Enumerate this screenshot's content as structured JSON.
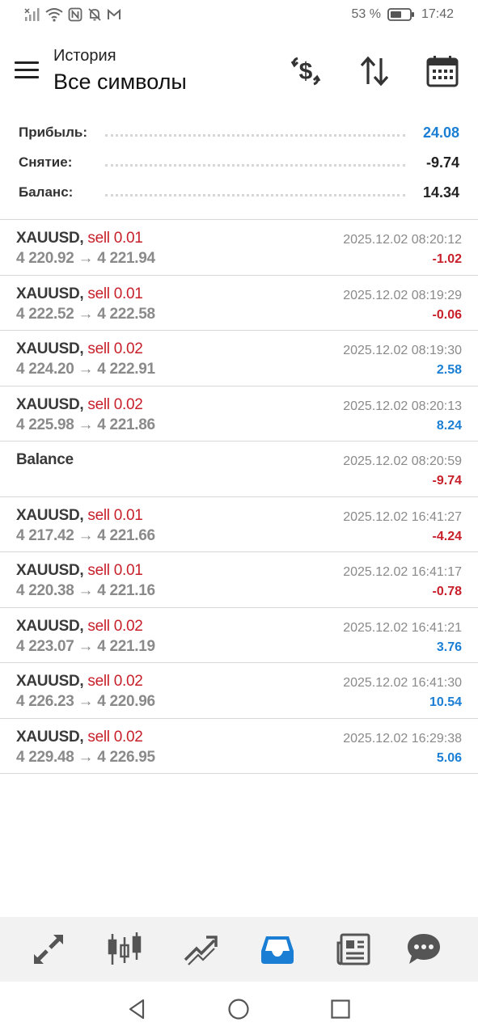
{
  "status_bar": {
    "battery_percent": "53 %",
    "time": "17:42",
    "icons": [
      "signal-icon",
      "wifi-icon",
      "nfc-icon",
      "bell-off-icon",
      "gmail-icon"
    ]
  },
  "header": {
    "title": "История",
    "subtitle": "Все символы",
    "actions": [
      "currency-exchange-icon",
      "sort-icon",
      "calendar-icon"
    ]
  },
  "summary": {
    "profit_label": "Прибыль:",
    "profit_value": "24.08",
    "withdrawal_label": "Снятие:",
    "withdrawal_value": "-9.74",
    "balance_label": "Баланс:",
    "balance_value": "14.34",
    "profit_color": "#1a7fd4"
  },
  "deals": [
    {
      "symbol": "XAUUSD,",
      "type": "sell 0.01",
      "prices": "4 220.92 → 4 221.94",
      "time": "2025.12.02 08:20:12",
      "profit": "-1.02",
      "sign": "neg"
    },
    {
      "symbol": "XAUUSD,",
      "type": "sell 0.01",
      "prices": "4 222.52 → 4 222.58",
      "time": "2025.12.02 08:19:29",
      "profit": "-0.06",
      "sign": "neg"
    },
    {
      "symbol": "XAUUSD,",
      "type": "sell 0.02",
      "prices": "4 224.20 → 4 222.91",
      "time": "2025.12.02 08:19:30",
      "profit": "2.58",
      "sign": "pos"
    },
    {
      "symbol": "XAUUSD,",
      "type": "sell 0.02",
      "prices": "4 225.98 → 4 221.86",
      "time": "2025.12.02 08:20:13",
      "profit": "8.24",
      "sign": "pos"
    },
    {
      "symbol": "Balance",
      "type": "",
      "prices": "",
      "time": "2025.12.02 08:20:59",
      "profit": "-9.74",
      "sign": "neg"
    },
    {
      "symbol": "XAUUSD,",
      "type": "sell 0.01",
      "prices": "4 217.42 → 4 221.66",
      "time": "2025.12.02 16:41:27",
      "profit": "-4.24",
      "sign": "neg"
    },
    {
      "symbol": "XAUUSD,",
      "type": "sell 0.01",
      "prices": "4 220.38 → 4 221.16",
      "time": "2025.12.02 16:41:17",
      "profit": "-0.78",
      "sign": "neg"
    },
    {
      "symbol": "XAUUSD,",
      "type": "sell 0.02",
      "prices": "4 223.07 → 4 221.19",
      "time": "2025.12.02 16:41:21",
      "profit": "3.76",
      "sign": "pos"
    },
    {
      "symbol": "XAUUSD,",
      "type": "sell 0.02",
      "prices": "4 226.23 → 4 220.96",
      "time": "2025.12.02 16:41:30",
      "profit": "10.54",
      "sign": "pos"
    },
    {
      "symbol": "XAUUSD,",
      "type": "sell 0.02",
      "prices": "4 229.48 → 4 226.95",
      "time": "2025.12.02 16:29:38",
      "profit": "5.06",
      "sign": "pos"
    }
  ],
  "bottom_nav": {
    "items": [
      "quotes-icon",
      "chart-icon",
      "trade-icon",
      "history-icon",
      "news-icon",
      "messages-icon"
    ],
    "active": "history-icon",
    "active_color": "#1a7fd4"
  },
  "system_nav": [
    "back-icon",
    "home-icon",
    "recents-icon"
  ]
}
